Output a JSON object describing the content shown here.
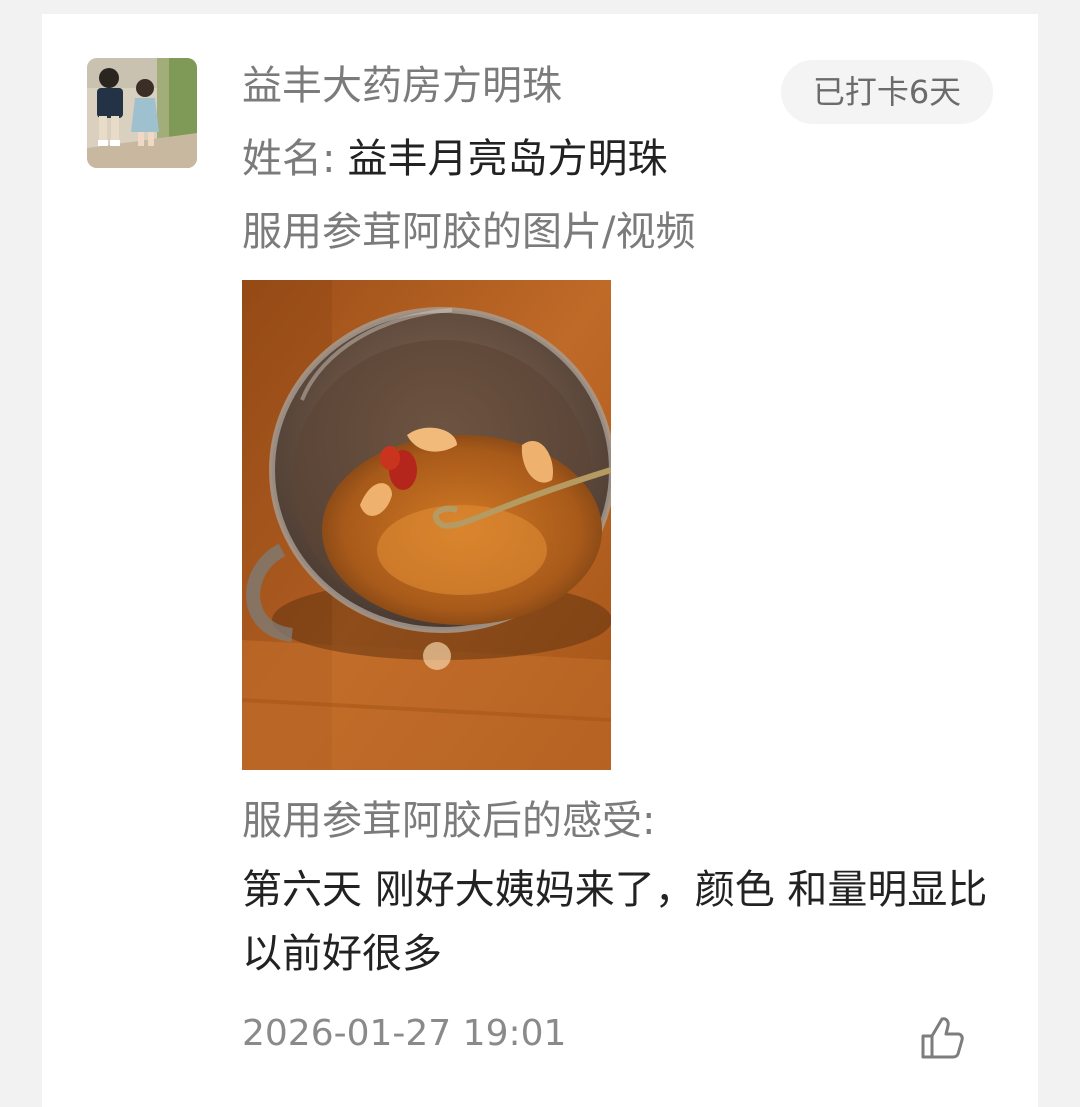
{
  "post": {
    "author_name": "益丰大药房方明珠",
    "checkin_badge": "已打卡6天",
    "name_field": {
      "label": "姓名:",
      "value": "益丰月亮岛方明珠"
    },
    "media_label": "服用参茸阿胶的图片/视频",
    "feeling_label": "服用参茸阿胶后的感受:",
    "feeling_text": "第六天 刚好大姨妈来了，颜色 和量明显比以前好很多",
    "timestamp": "2026-01-27 19:01"
  },
  "icons": {
    "like": "thumbs-up-icon"
  },
  "colors": {
    "secondary_text": "#7b7b7b",
    "primary_text": "#222222",
    "badge_bg": "#f4f4f4",
    "page_bg": "#f2f2f2",
    "card_bg": "#ffffff"
  }
}
